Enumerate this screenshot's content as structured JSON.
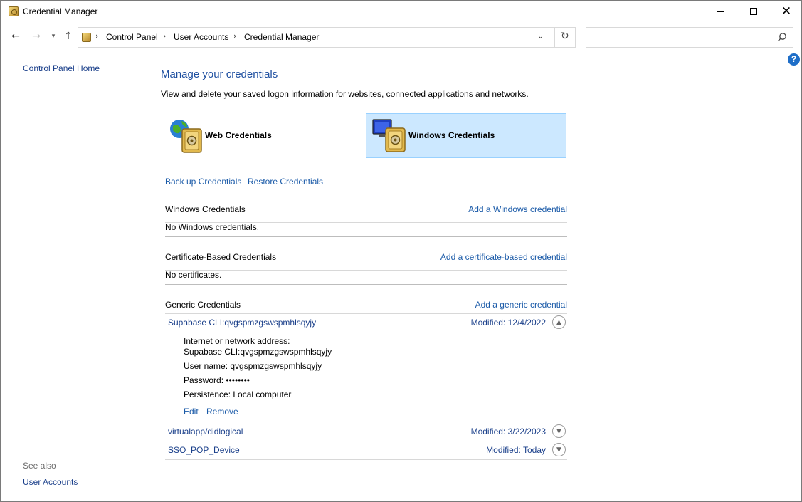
{
  "window": {
    "title": "Credential Manager",
    "minimize_glyph": "",
    "maximize_glyph": "",
    "close_glyph": "✕"
  },
  "nav": {
    "back_glyph": "←",
    "forward_glyph": "→",
    "recent_glyph": "▾",
    "up_glyph": "↑",
    "breadcrumbs": [
      "Control Panel",
      "User Accounts",
      "Credential Manager"
    ],
    "separator": "›",
    "address_dropdown_glyph": "⌄",
    "refresh_glyph": "↻",
    "search_value": "",
    "search_placeholder": ""
  },
  "help_label": "?",
  "sidebar": {
    "home_link": "Control Panel Home",
    "see_also": "See also",
    "see_also_links": [
      "User Accounts"
    ]
  },
  "main": {
    "title": "Manage your credentials",
    "description": "View and delete your saved logon information for websites, connected applications and networks.",
    "tiles": [
      {
        "label": "Web Credentials",
        "selected": false
      },
      {
        "label": "Windows Credentials",
        "selected": true
      }
    ],
    "actions": [
      "Back up Credentials",
      "Restore Credentials"
    ],
    "sections": {
      "windows": {
        "title": "Windows Credentials",
        "add_link": "Add a Windows credential",
        "empty_text": "No Windows credentials."
      },
      "certificate": {
        "title": "Certificate-Based Credentials",
        "add_link": "Add a certificate-based credential",
        "empty_text": "No certificates."
      },
      "generic": {
        "title": "Generic Credentials",
        "add_link": "Add a generic credential",
        "items": [
          {
            "name": "Supabase CLI:qvgspmzgswspmhlsqyjy",
            "modified": "Modified:  12/4/2022",
            "expanded": true,
            "toggle_glyph": "▲",
            "details": {
              "address_label": "Internet or network address:",
              "address_value": "Supabase CLI:qvgspmzgswspmhlsqyjy",
              "username": "User name:  qvgspmzgswspmhlsqyjy",
              "password": "Password:  ••••••••",
              "persistence": "Persistence:  Local computer",
              "edit_link": "Edit",
              "remove_link": "Remove"
            }
          },
          {
            "name": "virtualapp/didlogical",
            "modified": "Modified:  3/22/2023",
            "expanded": false,
            "toggle_glyph": "▼"
          },
          {
            "name": "SSO_POP_Device",
            "modified": "Modified:  Today",
            "expanded": false,
            "toggle_glyph": "▼"
          }
        ]
      }
    }
  },
  "colors": {
    "link": "#1a5aa8",
    "title": "#1e4fa0",
    "selected_tile_bg": "#cce8ff",
    "selected_tile_border": "#99d1ff"
  },
  "icons": {
    "app": "credential-vault-icon",
    "web_tile": "globe-vault-icon",
    "windows_tile": "monitor-vault-icon"
  }
}
